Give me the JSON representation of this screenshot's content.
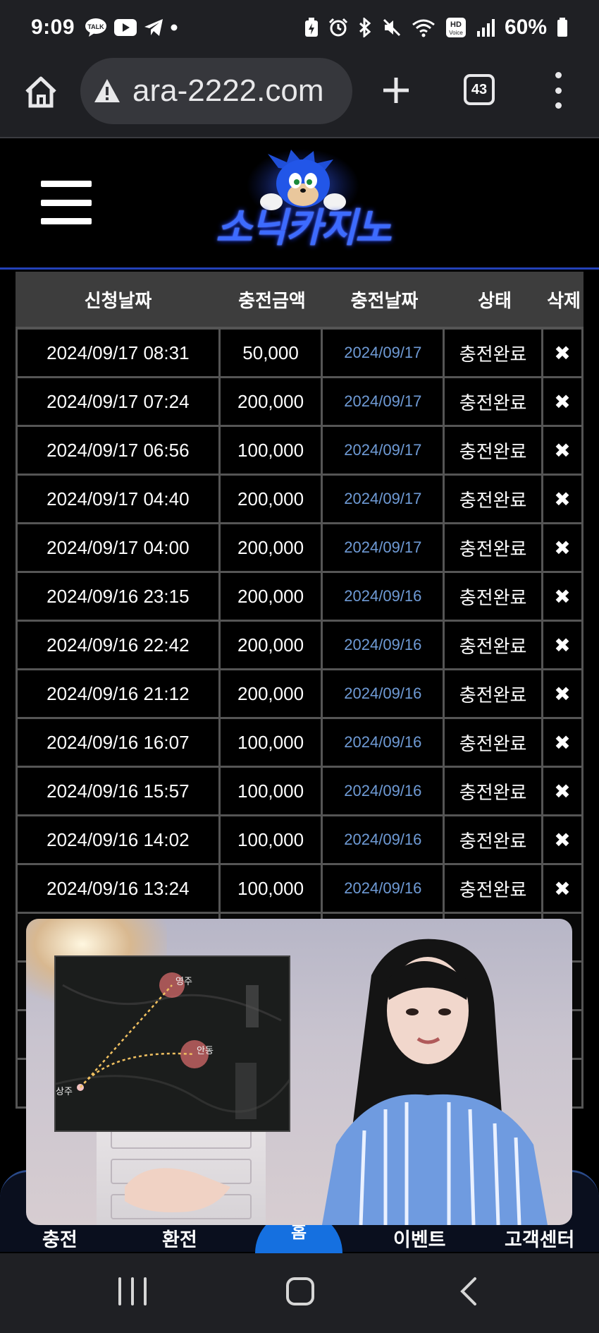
{
  "status": {
    "time": "9:09",
    "battery": "60%",
    "hd_voice": "HD Voice",
    "chat_badge": "TALK"
  },
  "browser": {
    "url": "ara-2222.com",
    "tab_count": "43"
  },
  "site": {
    "logo_text": "소닉카지노"
  },
  "table": {
    "headers": [
      "신청날짜",
      "충전금액",
      "충전날짜",
      "상태",
      "삭제"
    ],
    "rows": [
      {
        "requested": "2024/09/17 08:31",
        "amount": "50,000",
        "date": "2024/09/17",
        "status": "충전완료"
      },
      {
        "requested": "2024/09/17 07:24",
        "amount": "200,000",
        "date": "2024/09/17",
        "status": "충전완료"
      },
      {
        "requested": "2024/09/17 06:56",
        "amount": "100,000",
        "date": "2024/09/17",
        "status": "충전완료"
      },
      {
        "requested": "2024/09/17 04:40",
        "amount": "200,000",
        "date": "2024/09/17",
        "status": "충전완료"
      },
      {
        "requested": "2024/09/17 04:00",
        "amount": "200,000",
        "date": "2024/09/17",
        "status": "충전완료"
      },
      {
        "requested": "2024/09/16 23:15",
        "amount": "200,000",
        "date": "2024/09/16",
        "status": "충전완료"
      },
      {
        "requested": "2024/09/16 22:42",
        "amount": "200,000",
        "date": "2024/09/16",
        "status": "충전완료"
      },
      {
        "requested": "2024/09/16 21:12",
        "amount": "200,000",
        "date": "2024/09/16",
        "status": "충전완료"
      },
      {
        "requested": "2024/09/16 16:07",
        "amount": "100,000",
        "date": "2024/09/16",
        "status": "충전완료"
      },
      {
        "requested": "2024/09/16 15:57",
        "amount": "100,000",
        "date": "2024/09/16",
        "status": "충전완료"
      },
      {
        "requested": "2024/09/16 14:02",
        "amount": "100,000",
        "date": "2024/09/16",
        "status": "충전완료"
      },
      {
        "requested": "2024/09/16 13:24",
        "amount": "100,000",
        "date": "2024/09/16",
        "status": "충전완료"
      }
    ],
    "delete_symbol": "✖"
  },
  "bottom_nav": {
    "charge": "충전",
    "exchange": "환전",
    "home": "홈",
    "event": "이벤트",
    "support": "고객센터"
  },
  "video_map": {
    "label_yeongju": "영주",
    "label_andong": "안동",
    "label_sangju": "상주"
  }
}
